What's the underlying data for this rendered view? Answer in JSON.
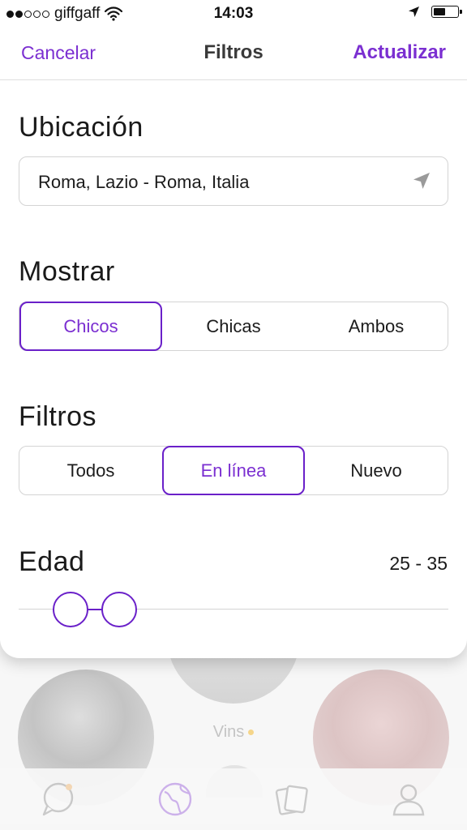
{
  "status_bar": {
    "carrier": "giffgaff",
    "time": "14:03"
  },
  "nav": {
    "cancel": "Cancelar",
    "title": "Filtros",
    "update": "Actualizar"
  },
  "location": {
    "title": "Ubicación",
    "value": "Roma, Lazio - Roma, Italia",
    "icon": "location-arrow-icon"
  },
  "show": {
    "title": "Mostrar",
    "options": [
      "Chicos",
      "Chicas",
      "Ambos"
    ],
    "selected": "Chicos"
  },
  "filters": {
    "title": "Filtros",
    "options": [
      "Todos",
      "En línea",
      "Nuevo"
    ],
    "selected": "En línea"
  },
  "age": {
    "title": "Edad",
    "range_label": "25 - 35",
    "min": 25,
    "max": 35,
    "range_min": 18,
    "range_max": 99
  },
  "background": {
    "profile_name": "Vins",
    "tabs": [
      "chat-icon",
      "globe-icon",
      "cards-icon",
      "profile-icon"
    ]
  },
  "colors": {
    "accent": "#7b2fd1",
    "accent_border": "#6a20c9"
  }
}
